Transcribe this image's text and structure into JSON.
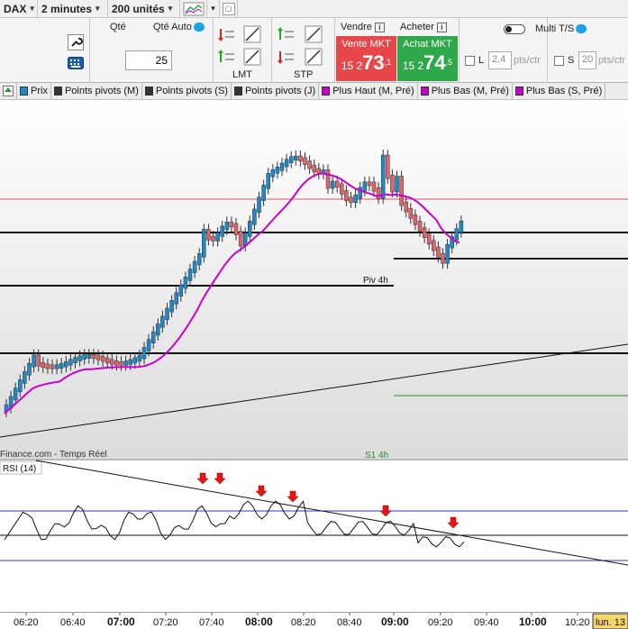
{
  "toolbar": {
    "instrument": "DAX",
    "timeframe": "2 minutes",
    "units": "200 unités"
  },
  "ticket": {
    "qty_label": "Qté",
    "qty_auto_label": "Qté Auto",
    "qty_value": "25",
    "lmt_label": "LMT",
    "stp_label": "STP",
    "sell_header": "Vendre",
    "buy_header": "Acheter",
    "sell_button_title": "Vente MKT",
    "sell_price_prefix": "15 2",
    "sell_price_big": "73",
    "sell_price_suffix": ",1",
    "buy_button_title": "Achat MKT",
    "buy_price_prefix": "15 2",
    "buy_price_big": "74",
    "buy_price_suffix": ",5",
    "limit_label": "L",
    "limit_pts": "2.4",
    "stop_label": "S",
    "stop_pts": "20",
    "pts_unit": "pts/ctr",
    "multi_ts_label": "Multi T/S",
    "sell_color": "#e8474a",
    "buy_color": "#2ea84a"
  },
  "legend": [
    {
      "label": "Prix",
      "color": "#1e88c8"
    },
    {
      "label": "Points pivots (M)",
      "color": "#333333"
    },
    {
      "label": "Points pivots (S)",
      "color": "#333333"
    },
    {
      "label": "Points pivots (J)",
      "color": "#333333"
    },
    {
      "label": "Plus Haut (M, Pré)",
      "color": "#cc00cc"
    },
    {
      "label": "Plus Bas (M, Pré)",
      "color": "#cc00cc"
    },
    {
      "label": "Plus Bas (S, Pré)",
      "color": "#cc00cc"
    }
  ],
  "chart": {
    "pivot_label": "Piv 4h",
    "s1_label": "S1 4h",
    "source_label": "Finance.com - Temps Réel",
    "rsi_label": "RSI (14)",
    "up_color": "#1e88c8",
    "down_color": "#e0646a",
    "ma_color": "#cc00cc",
    "x_ticks": [
      {
        "label": "06:20",
        "bold": false
      },
      {
        "label": "06:40",
        "bold": false
      },
      {
        "label": "07:00",
        "bold": true
      },
      {
        "label": "07:20",
        "bold": false
      },
      {
        "label": "07:40",
        "bold": false
      },
      {
        "label": "08:00",
        "bold": true
      },
      {
        "label": "08:20",
        "bold": false
      },
      {
        "label": "08:40",
        "bold": false
      },
      {
        "label": "09:00",
        "bold": true
      },
      {
        "label": "09:20",
        "bold": false
      },
      {
        "label": "09:40",
        "bold": false
      },
      {
        "label": "10:00",
        "bold": true
      },
      {
        "label": "10:20",
        "bold": false
      }
    ],
    "date_badge": "lun. 13"
  }
}
